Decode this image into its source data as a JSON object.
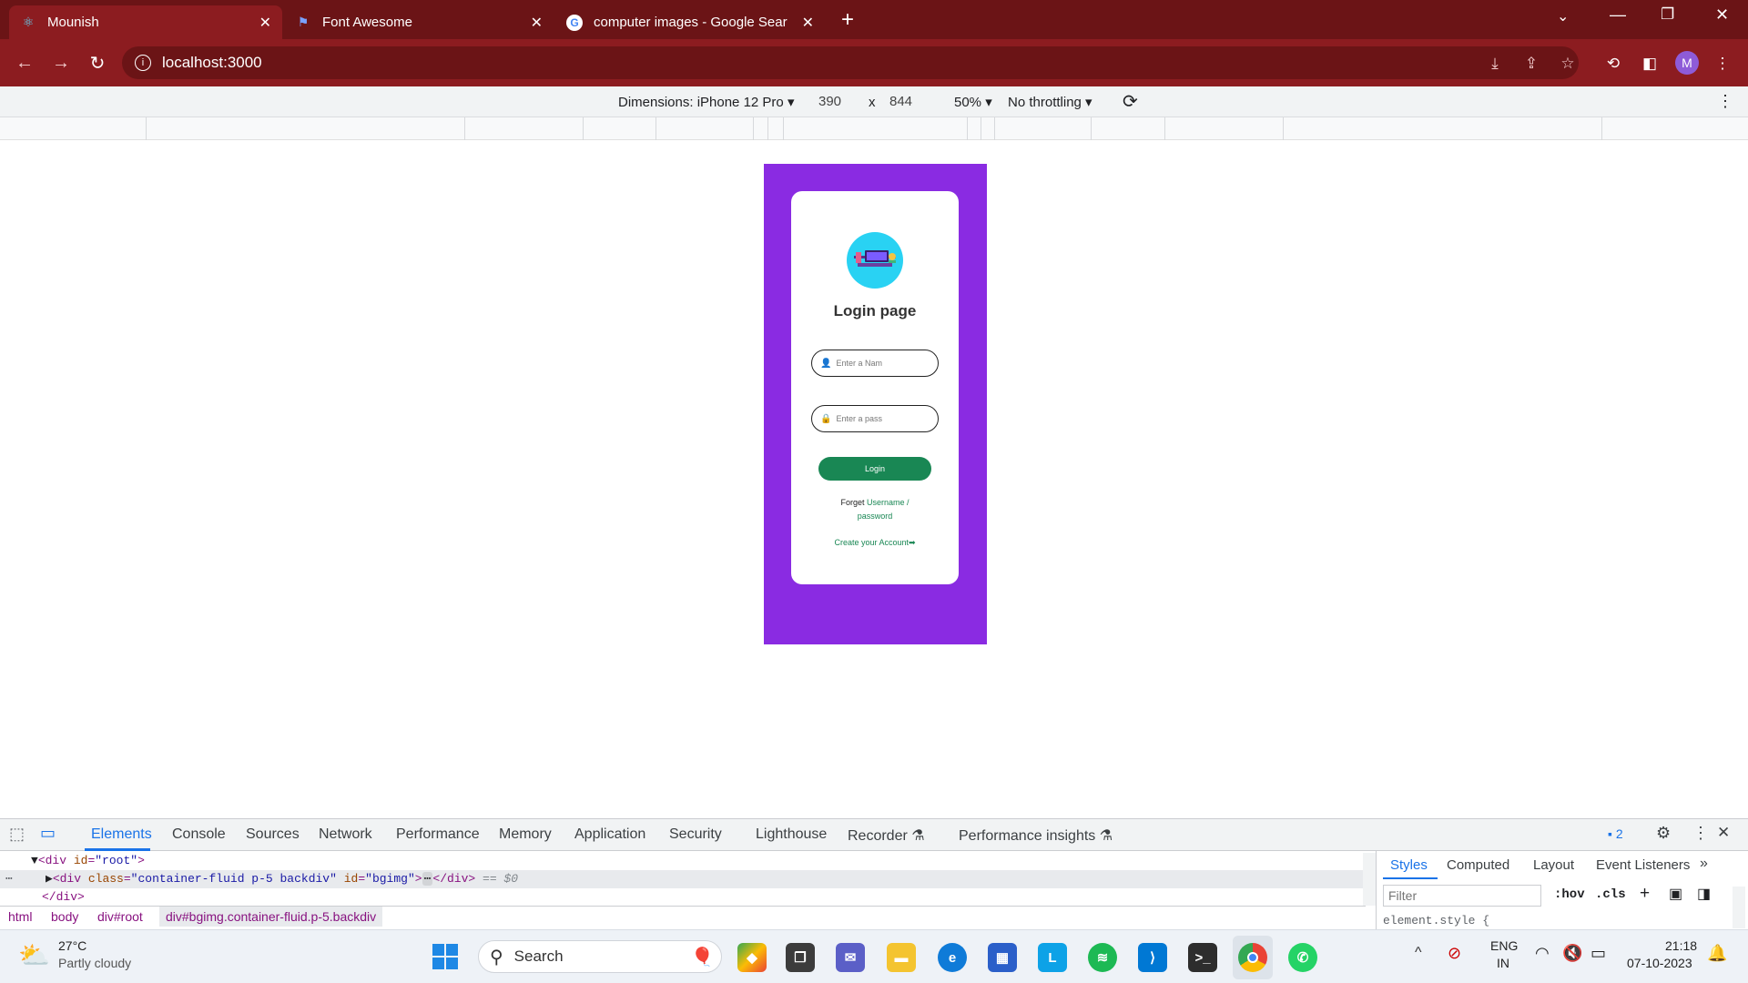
{
  "browser": {
    "tabs": [
      {
        "title": "Mounish",
        "icon": "react-icon",
        "active": true
      },
      {
        "title": "Font Awesome",
        "icon": "font-awesome-flag-icon",
        "active": false
      },
      {
        "title": "computer images - Google Sear",
        "icon": "google-icon",
        "active": false
      }
    ],
    "new_tab_label": "+",
    "url": "localhost:3000",
    "profile_initial": "M",
    "accent": "#8c1c20"
  },
  "device_toolbar": {
    "dimensions_label": "Dimensions: iPhone 12 Pro",
    "width": "390",
    "times": "x",
    "height": "844",
    "zoom": "50%",
    "throttling": "No throttling"
  },
  "app": {
    "background_color": "#8a2be2",
    "title": "Login page",
    "username_placeholder": "Enter a Nam",
    "password_placeholder": "Enter a pass",
    "login_label": "Login",
    "forget_prefix": "Forget",
    "forget_link1": "Username /",
    "forget_link2": "password",
    "create_account": "Create your Account",
    "create_arrow": "➡"
  },
  "devtools": {
    "tabs": [
      "Elements",
      "Console",
      "Sources",
      "Network",
      "Performance",
      "Memory",
      "Application",
      "Security",
      "Lighthouse",
      "Recorder",
      "Performance insights"
    ],
    "issues_count": "2",
    "dom": {
      "line1_tag": "<div ",
      "line1_attr": "id",
      "line1_val": "\"root\"",
      "line1_close": ">",
      "line2_tag": "<div ",
      "line2_attr1": "class",
      "line2_val1": "\"container-fluid p-5 backdiv\"",
      "line2_attr2": "id",
      "line2_val2": "\"bgimg\"",
      "line2_close": ">",
      "line2_end": "</div>",
      "line2_marker": "== $0",
      "line3": "</div>"
    },
    "breadcrumbs": [
      "html",
      "body",
      "div#root",
      "div#bgimg.container-fluid.p-5.backdiv"
    ],
    "styles_tabs": [
      "Styles",
      "Computed",
      "Layout",
      "Event Listeners"
    ],
    "filter_placeholder": "Filter",
    "hov": ":hov",
    "cls": ".cls",
    "element_style": "element.style {"
  },
  "taskbar": {
    "temperature": "27°C",
    "weather": "Partly cloudy",
    "search_label": "Search",
    "lang1": "ENG",
    "lang2": "IN",
    "time": "21:18",
    "date": "07-10-2023"
  }
}
